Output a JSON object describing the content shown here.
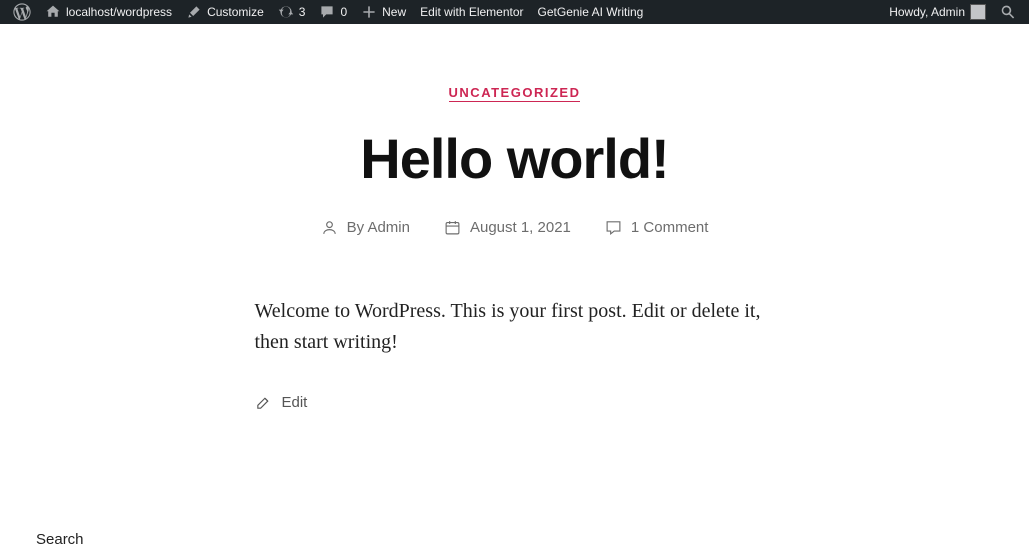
{
  "adminbar": {
    "site_name": "localhost/wordpress",
    "customize": "Customize",
    "updates_count": "3",
    "comments_count": "0",
    "new_label": "New",
    "edit_elementor": "Edit with Elementor",
    "getgenie": "GetGenie AI Writing",
    "howdy": "Howdy, Admin"
  },
  "post": {
    "category": "UNCATEGORIZED",
    "title": "Hello world!",
    "by_label": "By ",
    "author": "Admin",
    "date": "August 1, 2021",
    "comments": "1 Comment",
    "body": "Welcome to WordPress. This is your first post. Edit or delete it, then start writing!",
    "edit_label": "Edit"
  },
  "widgets": {
    "search_heading": "Search"
  }
}
